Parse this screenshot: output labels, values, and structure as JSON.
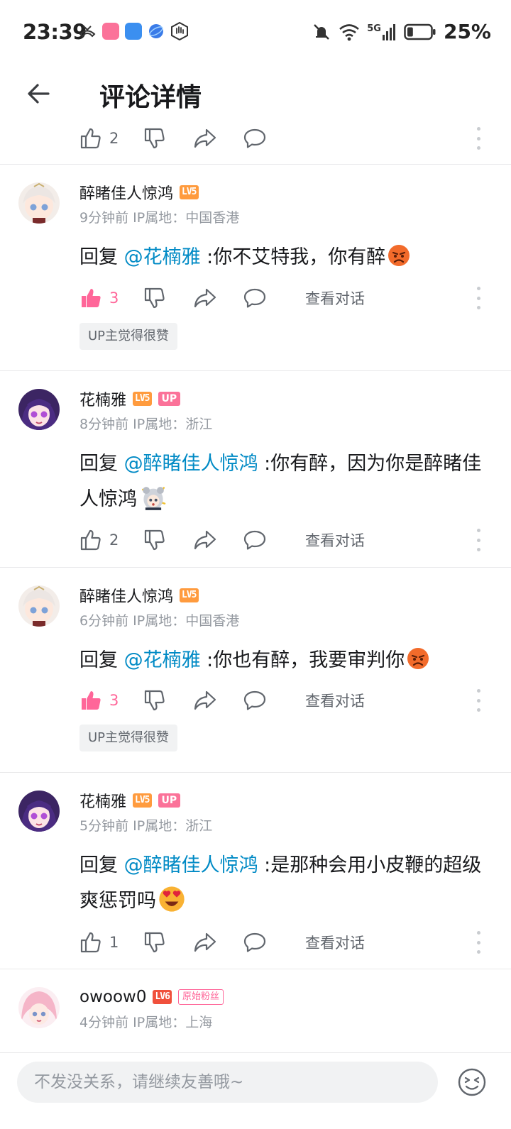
{
  "status_bar": {
    "time": "23:39",
    "network": "5G",
    "battery": "25%",
    "battery_level": 0.25
  },
  "header": {
    "title": "评论详情"
  },
  "root_actions": {
    "like_count": "2"
  },
  "common": {
    "view_conversation": "查看对话",
    "up_liked": "UP主觉得很赞",
    "level_5": "LV5",
    "level_6": "LV6",
    "up_badge": "UP"
  },
  "comments": [
    {
      "username": "醉睹佳人惊鸿",
      "time": "9分钟前",
      "ip": "IP属地：中国香港",
      "reply_prefix": "回复 ",
      "mention": "@花楠雅",
      "text": " :你不艾特我，你有醉",
      "emoji": "angry-emoji",
      "like_count": "3",
      "liked": true,
      "up_liked": true
    },
    {
      "username": "花楠雅",
      "time": "8分钟前",
      "ip": "IP属地：浙江",
      "reply_prefix": "回复 ",
      "mention": "@醉睹佳人惊鸿",
      "text": " :你有醉，因为你是醉睹佳人惊鸿",
      "emoji": "chibi-sticker",
      "like_count": "2",
      "liked": false,
      "up_liked": false
    },
    {
      "username": "醉睹佳人惊鸿",
      "time": "6分钟前",
      "ip": "IP属地：中国香港",
      "reply_prefix": "回复 ",
      "mention": "@花楠雅",
      "text": " :你也有醉，我要审判你",
      "emoji": "angry-emoji",
      "like_count": "3",
      "liked": true,
      "up_liked": true
    },
    {
      "username": "花楠雅",
      "time": "5分钟前",
      "ip": "IP属地：浙江",
      "reply_prefix": "回复 ",
      "mention": "@醉睹佳人惊鸿",
      "text": " :是那种会用小皮鞭的超级爽惩罚吗",
      "emoji": "heart-eyes-emoji",
      "like_count": "1",
      "liked": false,
      "up_liked": false
    },
    {
      "username": "owoow0",
      "time": "4分钟前",
      "ip": "IP属地：上海",
      "fan_badge": "原始粉丝"
    }
  ],
  "reply_bar": {
    "placeholder": "不发没关系，请继续友善哦~"
  },
  "colors": {
    "accent_pink": "#ff6699",
    "mention_blue": "#008ac5",
    "level5_orange": "#ff9b3e",
    "level6_red": "#f0503c",
    "up_badge_pink": "#fb7299"
  }
}
